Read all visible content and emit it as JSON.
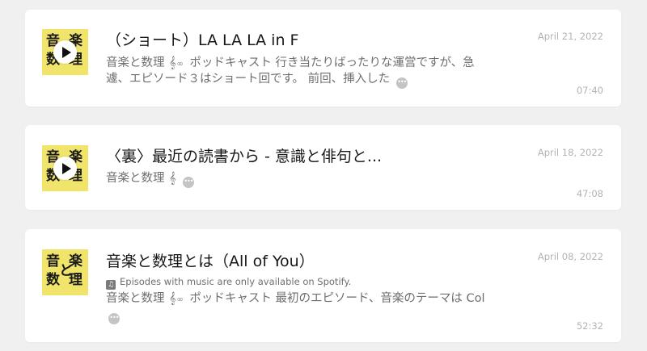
{
  "thumbnail": {
    "chars": [
      "音",
      "楽",
      "数",
      "理",
      "と"
    ],
    "bg_color": "#f1e46a"
  },
  "episodes": [
    {
      "title": "（ショート）LA LA LA in F",
      "desc_start": "音楽と数理",
      "desc_rest": "ポッドキャスト 行き当たりばったりな運営ですが、急遽、エピソード３はショート回です。 前回、挿入した",
      "date": "April 21, 2022",
      "duration": "07:40"
    },
    {
      "title": "〈裏〉最近の読書から - 意識と俳句と...",
      "desc_start": "音楽と数理",
      "desc_rest": "",
      "date": "April 18, 2022",
      "duration": "47:08"
    },
    {
      "title": "音楽と数理とは（All of You）",
      "notice": "Episodes with music are only available on Spotify.",
      "desc_start": "音楽と数理",
      "desc_rest": "ポッドキャスト 最初のエピソード、音楽のテーマは Col",
      "date": "April 08, 2022",
      "duration": "52:32"
    }
  ],
  "icons": {
    "clef": "𝄞",
    "infinity": "∞",
    "more": "•••",
    "note": "♫"
  }
}
